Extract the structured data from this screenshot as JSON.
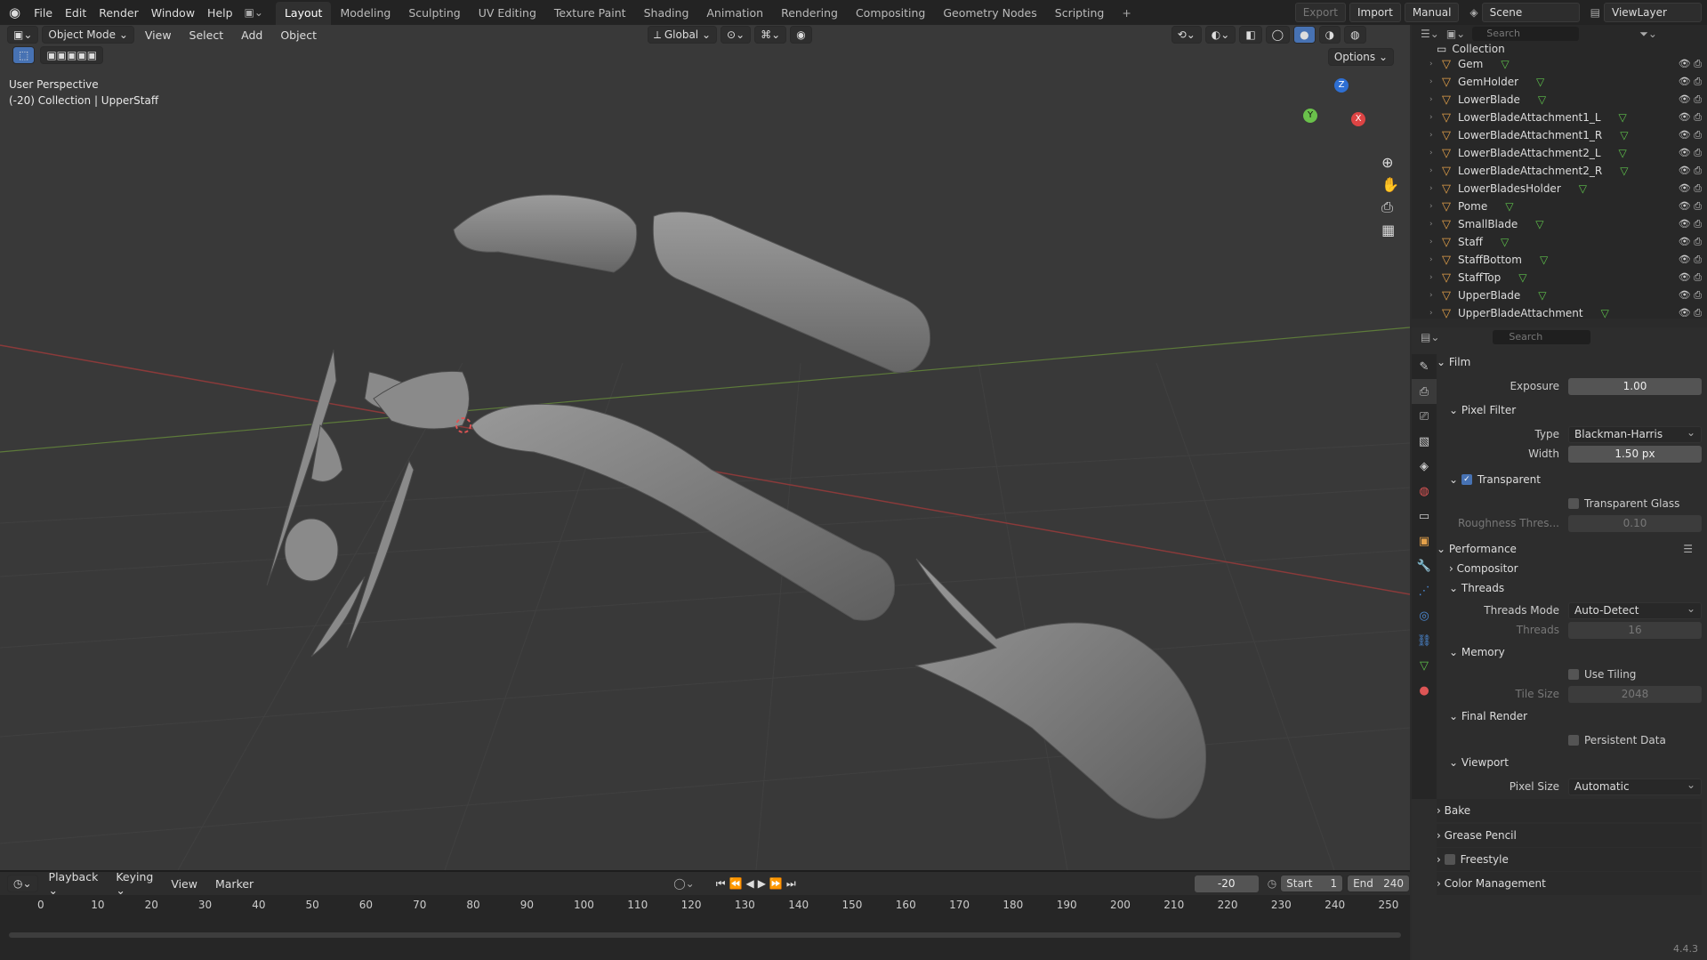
{
  "menu": [
    "File",
    "Edit",
    "Render",
    "Window",
    "Help"
  ],
  "workspaces": [
    {
      "label": "Layout",
      "active": true
    },
    {
      "label": "Modeling"
    },
    {
      "label": "Sculpting"
    },
    {
      "label": "UV Editing"
    },
    {
      "label": "Texture Paint"
    },
    {
      "label": "Shading"
    },
    {
      "label": "Animation"
    },
    {
      "label": "Rendering"
    },
    {
      "label": "Compositing"
    },
    {
      "label": "Geometry Nodes"
    },
    {
      "label": "Scripting"
    }
  ],
  "topright": {
    "export": "Export",
    "import": "Import",
    "manual": "Manual",
    "scene": "Scene",
    "viewlayer": "ViewLayer"
  },
  "viewport": {
    "mode": "Object Mode",
    "menus": [
      "View",
      "Select",
      "Add",
      "Object"
    ],
    "transform": "Global",
    "options": "Options",
    "overlay_title": "User Perspective",
    "overlay_sub": "(-20) Collection | UpperStaff",
    "axes": {
      "x": "X",
      "y": "Y",
      "z": "Z"
    }
  },
  "outliner": {
    "search_placeholder": "Search",
    "collection": "Collection",
    "items": [
      "Gem",
      "GemHolder",
      "LowerBlade",
      "LowerBladeAttachment1_L",
      "LowerBladeAttachment1_R",
      "LowerBladeAttachment2_L",
      "LowerBladeAttachment2_R",
      "LowerBladesHolder",
      "Pome",
      "SmallBlade",
      "Staff",
      "StaffBottom",
      "StaffTop",
      "UpperBlade",
      "UpperBladeAttachment"
    ]
  },
  "properties": {
    "search_placeholder": "Search",
    "film": "Film",
    "exposure_label": "Exposure",
    "exposure": "1.00",
    "pixel_filter": "Pixel Filter",
    "type_label": "Type",
    "type": "Blackman-Harris",
    "width_label": "Width",
    "width": "1.50 px",
    "transparent": "Transparent",
    "transparent_glass": "Transparent Glass",
    "roughness_label": "Roughness Thres...",
    "roughness": "0.10",
    "performance": "Performance",
    "compositor": "Compositor",
    "threads": "Threads",
    "threads_mode_label": "Threads Mode",
    "threads_mode": "Auto-Detect",
    "threads_label": "Threads",
    "threads_val": "16",
    "memory": "Memory",
    "use_tiling": "Use Tiling",
    "tile_size_label": "Tile Size",
    "tile_size": "2048",
    "final_render": "Final Render",
    "persistent_data": "Persistent Data",
    "viewport": "Viewport",
    "pixel_size_label": "Pixel Size",
    "pixel_size": "Automatic",
    "bake": "Bake",
    "grease_pencil": "Grease Pencil",
    "freestyle": "Freestyle",
    "color_management": "Color Management"
  },
  "timeline": {
    "menus": [
      "Playback",
      "Keying",
      "View",
      "Marker"
    ],
    "current": "-20",
    "start_label": "Start",
    "start": "1",
    "end_label": "End",
    "end": "240",
    "ticks": [
      "0",
      "10",
      "20",
      "30",
      "40",
      "50",
      "60",
      "70",
      "80",
      "90",
      "100",
      "110",
      "120",
      "130",
      "140",
      "150",
      "160",
      "170",
      "180",
      "190",
      "200",
      "210",
      "220",
      "230",
      "240",
      "250"
    ]
  },
  "version": "4.4.3"
}
